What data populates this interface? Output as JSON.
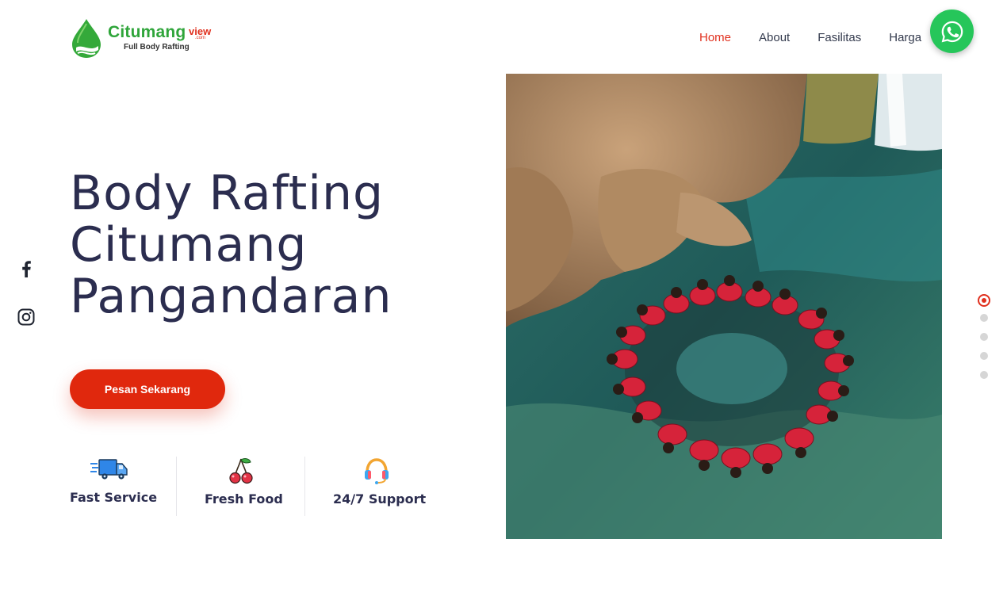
{
  "brand": {
    "name": "Citumang",
    "suffix": "view",
    "domain": ".com",
    "tagline": "Full Body Rafting",
    "logo_color": "#2fa53a",
    "accent_color": "#e0301e"
  },
  "nav": {
    "items": [
      {
        "label": "Home",
        "active": true
      },
      {
        "label": "About",
        "active": false
      },
      {
        "label": "Fasilitas",
        "active": false
      },
      {
        "label": "Harga",
        "active": false
      }
    ]
  },
  "whatsapp": {
    "icon": "whatsapp-icon",
    "color": "#26c65a"
  },
  "social": [
    {
      "icon": "facebook-icon"
    },
    {
      "icon": "instagram-icon"
    }
  ],
  "hero": {
    "title_lines": [
      "Body Rafting",
      "Citumang",
      "Pangandaran"
    ],
    "cta_label": "Pesan Sekarang",
    "cta_color": "#e0280d"
  },
  "features": [
    {
      "label": "Fast Service",
      "icon": "delivery-truck-icon"
    },
    {
      "label": "Fresh Food",
      "icon": "cherry-icon"
    },
    {
      "label": "24/7 Support",
      "icon": "headset-icon"
    }
  ],
  "slider": {
    "count": 5,
    "active_index": 0
  }
}
